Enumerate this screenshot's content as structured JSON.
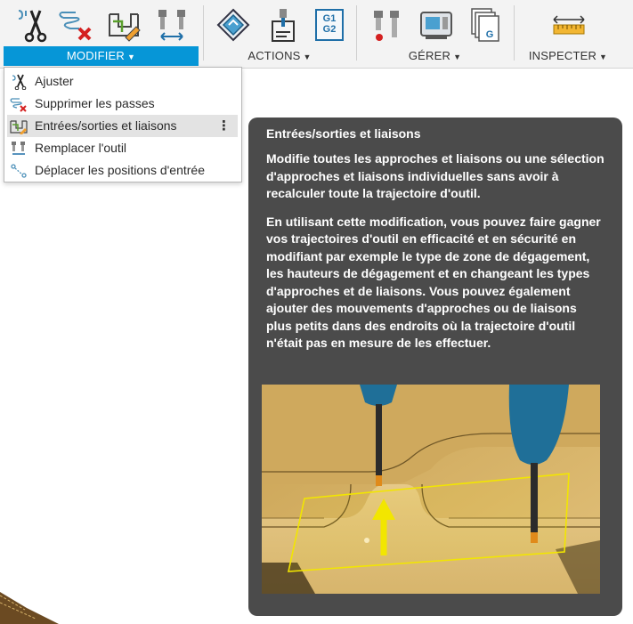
{
  "toolbar": {
    "groups": [
      {
        "label": "MODIFIER",
        "active": true,
        "icons": [
          "trim-icon",
          "delete-passes-icon",
          "edit-links-icon",
          "replace-tool-icon"
        ]
      },
      {
        "label": "ACTIONS",
        "active": false,
        "icons": [
          "post-process-icon",
          "setup-sheet-icon",
          "nc-program-icon"
        ]
      },
      {
        "label": "GÉRER",
        "active": false,
        "icons": [
          "tool-library-icon",
          "machine-library-icon",
          "templates-icon"
        ]
      },
      {
        "label": "INSPECTER",
        "active": false,
        "icons": [
          "measure-icon"
        ]
      }
    ],
    "nc_icon_text": [
      "G1",
      "G2"
    ],
    "template_icon_text": "G"
  },
  "menu": {
    "items": [
      {
        "label": "Ajuster",
        "icon": "trim-icon"
      },
      {
        "label": "Supprimer les passes",
        "icon": "delete-passes-icon"
      },
      {
        "label": "Entrées/sorties et liaisons",
        "icon": "edit-links-icon",
        "highlighted": true
      },
      {
        "label": "Remplacer l'outil",
        "icon": "replace-tool-icon"
      },
      {
        "label": "Déplacer les positions d'entrée",
        "icon": "move-entry-icon"
      }
    ],
    "more_symbol": "⋮"
  },
  "tooltip": {
    "title": "Entrées/sorties et liaisons",
    "paragraph_1": "Modifie toutes les approches et liaisons ou une sélection d'approches et liaisons individuelles sans avoir à recalculer toute la trajectoire d'outil.",
    "paragraph_2": "En utilisant cette modification, vous pouvez faire gagner vos trajectoires d'outil en efficacité et en sécurité en modifiant par exemple le type de zone de dégagement, les hauteurs de dégagement et en changeant les types d'approches et de liaisons. Vous pouvez également ajouter des mouvements d'approches ou de liaisons plus petits dans des endroits où la trajectoire d'outil n'était pas en mesure de les effectuer."
  },
  "colors": {
    "accent": "#0696d7",
    "tooltip_bg": "#4b4b4b",
    "menu_hover": "#e3e3e3",
    "part_gold": "#d8b46a",
    "tool_blue": "#1f6f98",
    "arrow_yellow": "#f2e600"
  }
}
